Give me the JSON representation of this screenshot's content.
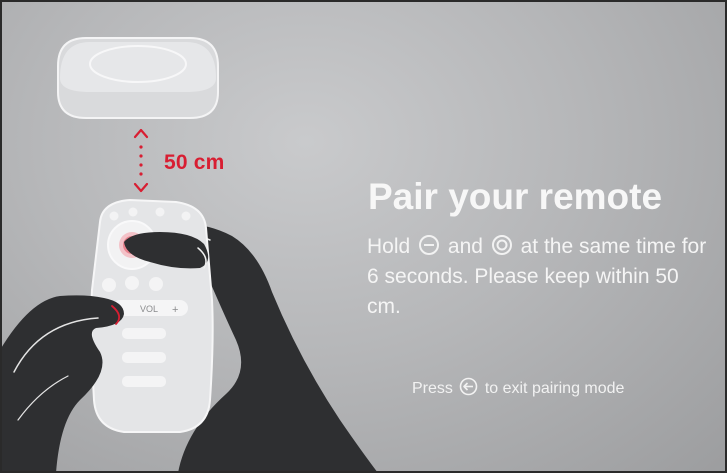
{
  "illustration": {
    "distance_label": "50 cm",
    "remote_vol_label": "VOL",
    "remote_vol_plus": "+",
    "accent_color": "#d81e32"
  },
  "pairing": {
    "title": "Pair your remote",
    "hold_text": "Hold",
    "and_text": "and",
    "rest_text": "at the same time for 6 seconds. Please keep within 50 cm.",
    "icons": [
      "minus-circle-icon",
      "target-circle-icon"
    ]
  },
  "footer": {
    "press_text": "Press",
    "exit_text": "to exit pairing mode",
    "icon": "back-arrow-circle-icon"
  },
  "colors": {
    "background": "#b6b7b9",
    "text": "#f7f7f7",
    "hand": "#2e2f31",
    "remote": "#e4e5e7"
  }
}
